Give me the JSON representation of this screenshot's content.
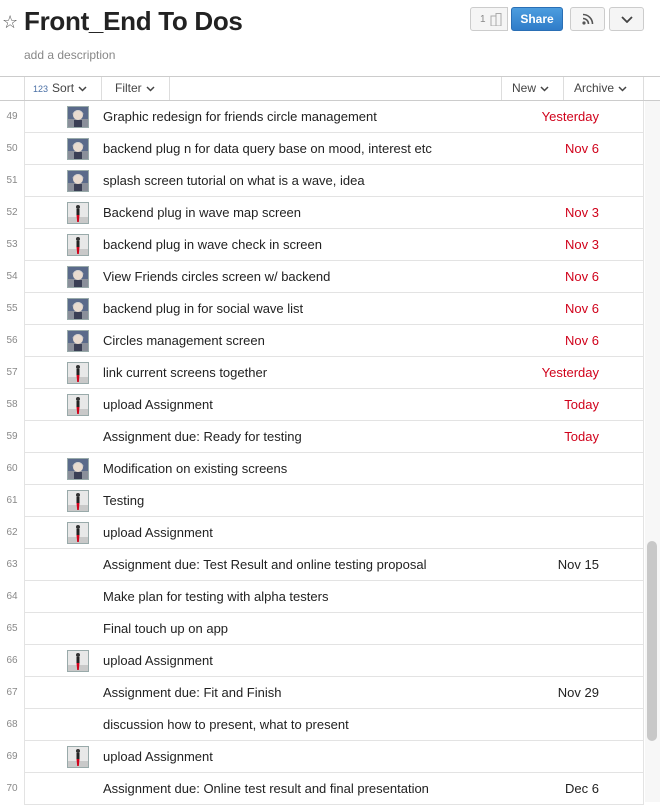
{
  "header": {
    "title": "Front_End To Dos",
    "description_placeholder": "add a description",
    "follower_count": "1",
    "share_label": "Share"
  },
  "toolbar": {
    "sort_icon": "123",
    "sort_label": "Sort",
    "filter_label": "Filter",
    "new_label": "New",
    "archive_label": "Archive"
  },
  "colors": {
    "due_red": "#d0021b",
    "share_blue": "#2f7cc9"
  },
  "rows": [
    {
      "num": "49",
      "avatar": "photo-avatar",
      "text": "Graphic redesign for friends circle management",
      "date": "Yesterday",
      "date_color": "red"
    },
    {
      "num": "50",
      "avatar": "photo-avatar",
      "text": "backend plug n for data query base on mood, interest etc",
      "date": "Nov 6",
      "date_color": "red"
    },
    {
      "num": "51",
      "avatar": "photo-avatar",
      "text": "splash screen tutorial on what is a wave, idea",
      "date": "",
      "date_color": ""
    },
    {
      "num": "52",
      "avatar": "figure-avatar",
      "text": "Backend plug in wave map screen",
      "date": "Nov 3",
      "date_color": "red"
    },
    {
      "num": "53",
      "avatar": "figure-avatar",
      "text": "backend plug in wave check in screen",
      "date": "Nov 3",
      "date_color": "red"
    },
    {
      "num": "54",
      "avatar": "photo-avatar",
      "text": "View Friends circles screen w/ backend",
      "date": "Nov 6",
      "date_color": "red"
    },
    {
      "num": "55",
      "avatar": "photo-avatar",
      "text": "backend plug in for social wave list",
      "date": "Nov 6",
      "date_color": "red"
    },
    {
      "num": "56",
      "avatar": "photo-avatar",
      "text": "Circles management screen",
      "date": "Nov 6",
      "date_color": "red"
    },
    {
      "num": "57",
      "avatar": "figure-avatar",
      "text": "link current screens together",
      "date": "Yesterday",
      "date_color": "red"
    },
    {
      "num": "58",
      "avatar": "figure-avatar",
      "text": "upload Assignment",
      "date": "Today",
      "date_color": "red"
    },
    {
      "num": "59",
      "avatar": "",
      "text": "Assignment due: Ready for testing",
      "date": "Today",
      "date_color": "red"
    },
    {
      "num": "60",
      "avatar": "photo-avatar",
      "text": "Modification on existing screens",
      "date": "",
      "date_color": ""
    },
    {
      "num": "61",
      "avatar": "figure-avatar",
      "text": "Testing",
      "date": "",
      "date_color": ""
    },
    {
      "num": "62",
      "avatar": "figure-avatar",
      "text": "upload Assignment",
      "date": "",
      "date_color": ""
    },
    {
      "num": "63",
      "avatar": "",
      "text": "Assignment due: Test Result and online testing proposal",
      "date": "Nov 15",
      "date_color": "black"
    },
    {
      "num": "64",
      "avatar": "",
      "text": "Make plan for testing with alpha testers",
      "date": "",
      "date_color": ""
    },
    {
      "num": "65",
      "avatar": "",
      "text": "Final touch up on app",
      "date": "",
      "date_color": ""
    },
    {
      "num": "66",
      "avatar": "figure-avatar",
      "text": "upload Assignment",
      "date": "",
      "date_color": ""
    },
    {
      "num": "67",
      "avatar": "",
      "text": "Assignment due: Fit and Finish",
      "date": "Nov 29",
      "date_color": "black"
    },
    {
      "num": "68",
      "avatar": "",
      "text": "discussion how to present, what to present",
      "date": "",
      "date_color": ""
    },
    {
      "num": "69",
      "avatar": "figure-avatar",
      "text": "upload Assignment",
      "date": "",
      "date_color": ""
    },
    {
      "num": "70",
      "avatar": "",
      "text": "Assignment due: Online test result and final presentation",
      "date": "Dec 6",
      "date_color": "black"
    }
  ]
}
